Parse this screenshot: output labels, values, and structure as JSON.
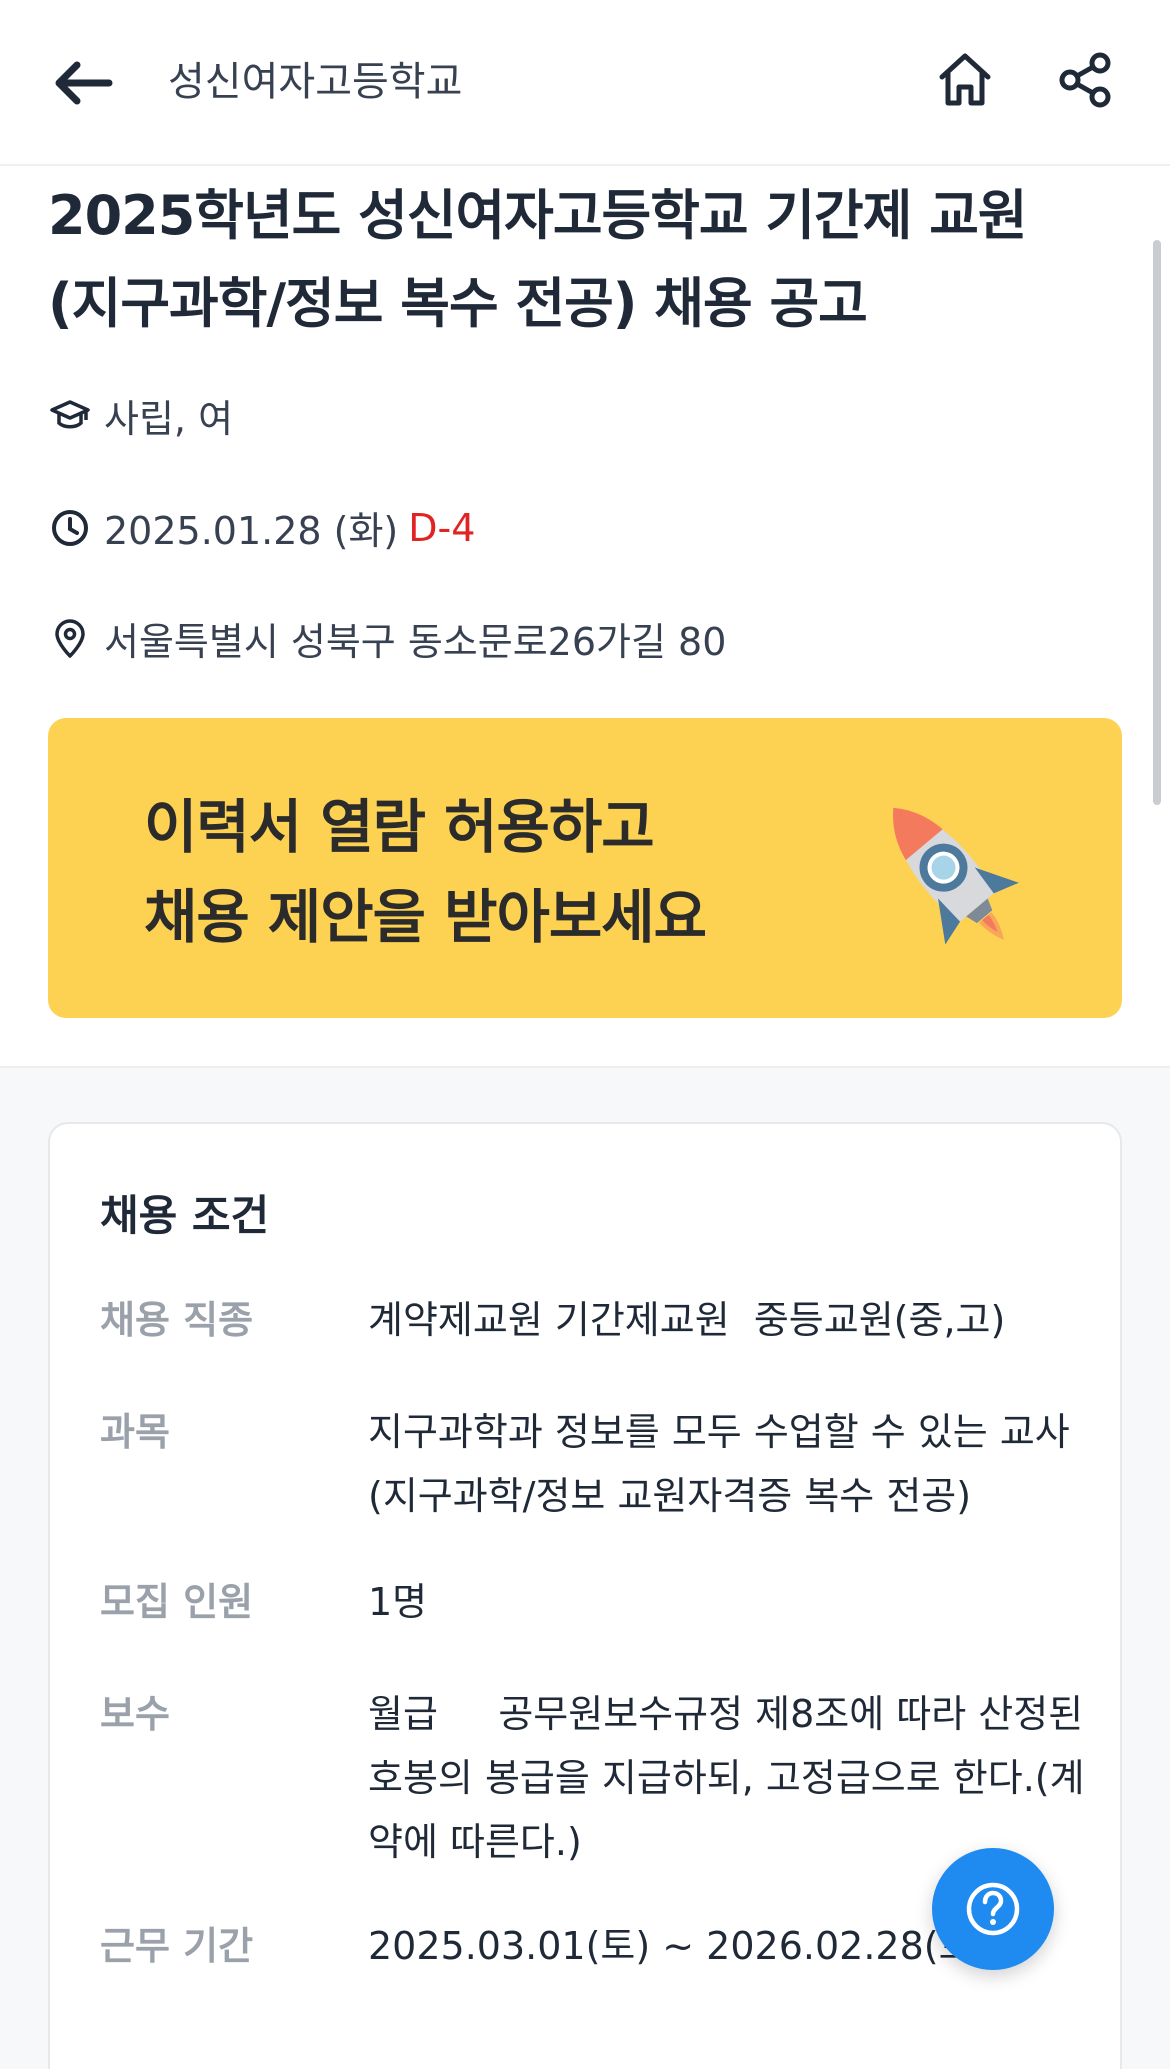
{
  "header": {
    "title": "성신여자고등학교",
    "back_icon": "arrow-left-icon",
    "home_icon": "home-icon",
    "share_icon": "share-icon"
  },
  "job": {
    "title": "2025학년도 성신여자고등학교 기간제 교원 (지구과학/정보 복수 전공) 채용 공고",
    "school_type": "사립, 여",
    "deadline": "2025.01.28 (화)",
    "dday": "D-4",
    "address": "서울특별시 성북구 동소문로26가길 80"
  },
  "banner": {
    "line1": "이력서 열람 허용하고",
    "line2": "채용 제안을 받아보세요",
    "image": "rocket-icon"
  },
  "conditions": {
    "title": "채용 조건",
    "rows": [
      {
        "label": "채용 직종",
        "value": "계약제교원 기간제교원  중등교원(중,고)"
      },
      {
        "label": "과목",
        "value": "지구과학과 정보를 모두 수업할 수 있는 교사(지구과학/정보 교원자격증 복수 전공)"
      },
      {
        "label": "모집 인원",
        "value": "1명"
      },
      {
        "label": "보수",
        "value": "월급     공무원보수규정 제8조에 따라 산정된 호봉의 봉급을 지급하되, 고정급으로 한다.(계약에 따른다.)"
      },
      {
        "label": "근무 기간",
        "value": "2025.03.01(토) ~ 2026.02.28(토)"
      }
    ]
  },
  "colors": {
    "banner_bg": "#fdd252",
    "dday": "#e02424",
    "fab": "#1f8bf0"
  }
}
